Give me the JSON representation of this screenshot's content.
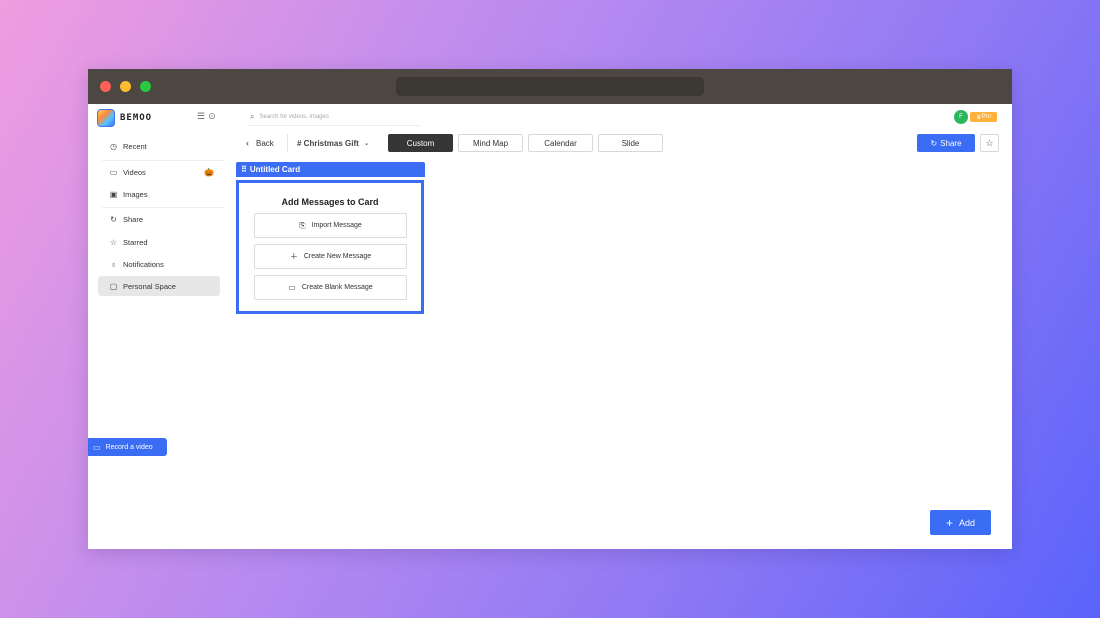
{
  "app": {
    "logo_text": "BEMOO"
  },
  "sidebar": {
    "items": [
      {
        "label": "Recent",
        "icon": "clock-icon"
      },
      {
        "label": "Videos",
        "icon": "video-icon"
      },
      {
        "label": "Images",
        "icon": "image-icon"
      },
      {
        "label": "Share",
        "icon": "share-icon"
      },
      {
        "label": "Starred",
        "icon": "star-icon"
      },
      {
        "label": "Notifications",
        "icon": "bell-icon"
      },
      {
        "label": "Personal Space",
        "icon": "folder-icon",
        "active": true
      }
    ],
    "record_label": "Record a video"
  },
  "header": {
    "search_placeholder": "Search for videos, images",
    "avatar_initial": "F",
    "pro_label": "Pro"
  },
  "toolbar": {
    "back_label": "Back",
    "board_name": "# Christmas Gift",
    "tabs": [
      {
        "label": "Custom",
        "active": true
      },
      {
        "label": "Mind Map"
      },
      {
        "label": "Calendar"
      },
      {
        "label": "Slide"
      }
    ],
    "share_label": "Share"
  },
  "card": {
    "title": "Untitled Card",
    "heading": "Add Messages to Card",
    "options": [
      {
        "label": "Import Message",
        "icon": "import-icon"
      },
      {
        "label": "Create New Message",
        "icon": "plus-icon"
      },
      {
        "label": "Create Blank Message",
        "icon": "blank-message-icon"
      }
    ]
  },
  "add_label": "Add",
  "colors": {
    "accent": "#3a6cf4",
    "active_tab": "#363636",
    "avatar": "#2db75c",
    "pro": "#ffb13b"
  }
}
